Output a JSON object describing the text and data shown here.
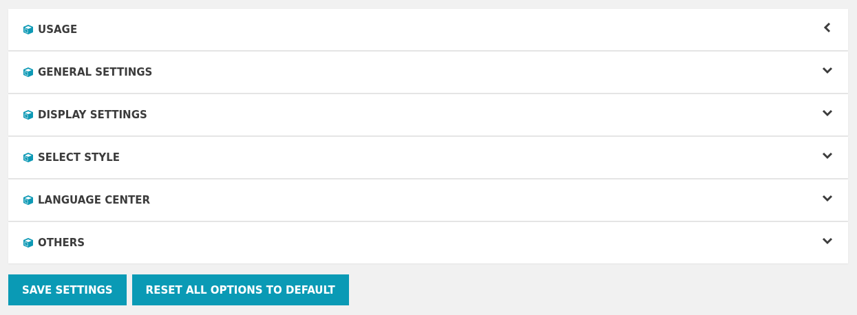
{
  "sections": [
    {
      "title": "USAGE",
      "expanded": true
    },
    {
      "title": "GENERAL SETTINGS",
      "expanded": false
    },
    {
      "title": "DISPLAY SETTINGS",
      "expanded": false
    },
    {
      "title": "SELECT STYLE",
      "expanded": false
    },
    {
      "title": "LANGUAGE CENTER",
      "expanded": false
    },
    {
      "title": "OTHERS",
      "expanded": false
    }
  ],
  "buttons": [
    "SAVE SETTINGS",
    "RESET ALL OPTIONS TO DEFAULT"
  ]
}
